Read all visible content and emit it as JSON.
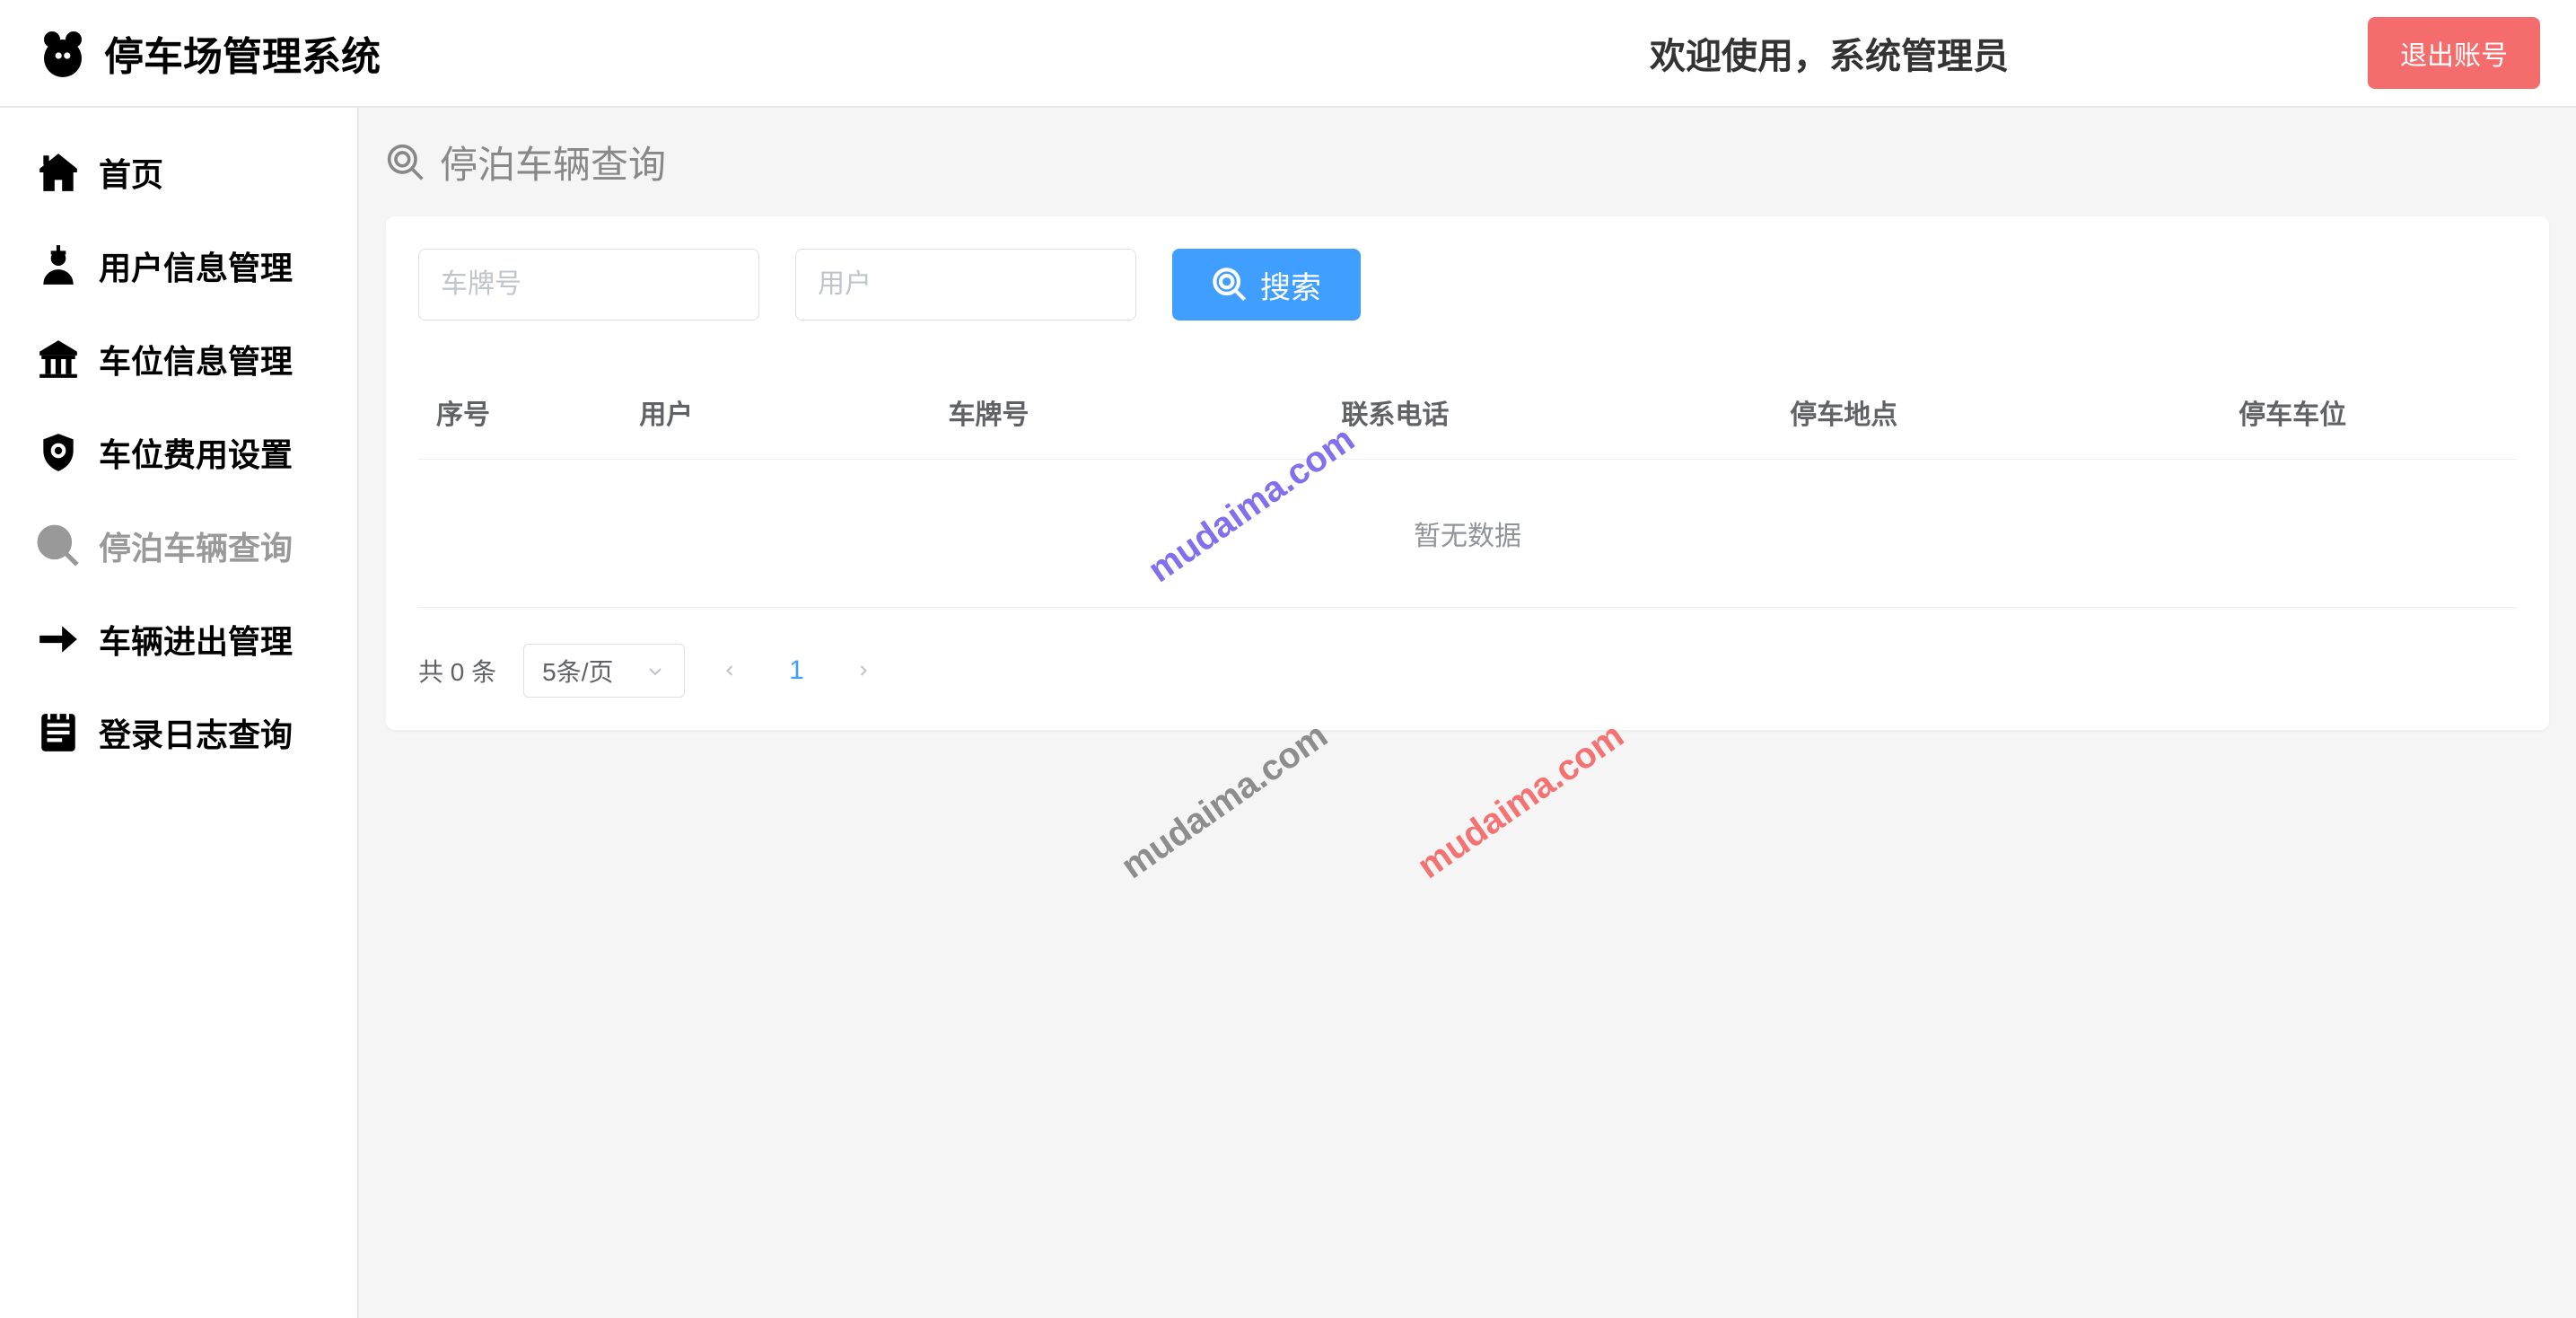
{
  "header": {
    "app_title": "停车场管理系统",
    "welcome_text": "欢迎使用，系统管理员",
    "logout_label": "退出账号"
  },
  "sidebar": {
    "items": [
      {
        "label": "首页",
        "icon": "home"
      },
      {
        "label": "用户信息管理",
        "icon": "user"
      },
      {
        "label": "车位信息管理",
        "icon": "parking"
      },
      {
        "label": "车位费用设置",
        "icon": "money"
      },
      {
        "label": "停泊车辆查询",
        "icon": "search",
        "active": true
      },
      {
        "label": "车辆进出管理",
        "icon": "arrow"
      },
      {
        "label": "登录日志查询",
        "icon": "log"
      }
    ]
  },
  "page": {
    "title": "停泊车辆查询"
  },
  "search": {
    "plate_placeholder": "车牌号",
    "user_placeholder": "用户",
    "button_label": "搜索"
  },
  "table": {
    "columns": [
      "序号",
      "用户",
      "车牌号",
      "联系电话",
      "停车地点",
      "停车车位"
    ],
    "empty_text": "暂无数据"
  },
  "pagination": {
    "total_text": "共 0 条",
    "page_size_label": "5条/页",
    "current_page": "1"
  },
  "watermark": "mudaima.com"
}
